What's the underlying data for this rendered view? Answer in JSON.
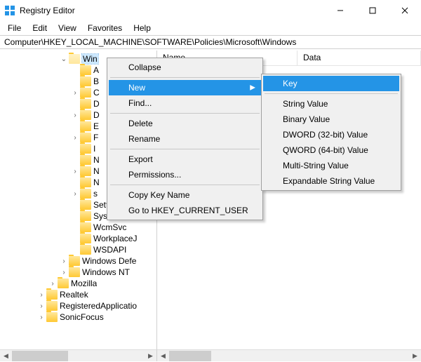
{
  "window": {
    "title": "Registry Editor"
  },
  "menubar": {
    "file": "File",
    "edit": "Edit",
    "view": "View",
    "favorites": "Favorites",
    "help": "Help"
  },
  "address": "Computer\\HKEY_LOCAL_MACHINE\\SOFTWARE\\Policies\\Microsoft\\Windows",
  "columns": {
    "name": "Name",
    "data": "Data"
  },
  "tree": [
    {
      "indent": 84,
      "chev": "down",
      "open": true,
      "label": "Win",
      "selected": true
    },
    {
      "indent": 100,
      "chev": "none",
      "label": "A"
    },
    {
      "indent": 100,
      "chev": "none",
      "label": "B"
    },
    {
      "indent": 100,
      "chev": "right",
      "label": "C"
    },
    {
      "indent": 100,
      "chev": "none",
      "label": "D"
    },
    {
      "indent": 100,
      "chev": "right",
      "label": "D"
    },
    {
      "indent": 100,
      "chev": "none",
      "label": "E"
    },
    {
      "indent": 100,
      "chev": "right",
      "label": "F"
    },
    {
      "indent": 100,
      "chev": "none",
      "label": "I"
    },
    {
      "indent": 100,
      "chev": "none",
      "label": "N"
    },
    {
      "indent": 100,
      "chev": "right",
      "label": "N"
    },
    {
      "indent": 100,
      "chev": "none",
      "label": "N"
    },
    {
      "indent": 100,
      "chev": "right",
      "label": "s"
    },
    {
      "indent": 100,
      "chev": "none",
      "label": "SettingSync"
    },
    {
      "indent": 100,
      "chev": "none",
      "label": "System"
    },
    {
      "indent": 100,
      "chev": "none",
      "label": "WcmSvc"
    },
    {
      "indent": 100,
      "chev": "none",
      "label": "WorkplaceJ"
    },
    {
      "indent": 100,
      "chev": "none",
      "label": "WSDAPI"
    },
    {
      "indent": 84,
      "chev": "right",
      "label": "Windows Defe"
    },
    {
      "indent": 84,
      "chev": "right",
      "label": "Windows NT"
    },
    {
      "indent": 68,
      "chev": "right",
      "label": "Mozilla"
    },
    {
      "indent": 52,
      "chev": "right",
      "label": "Realtek"
    },
    {
      "indent": 52,
      "chev": "right",
      "label": "RegisteredApplicatio"
    },
    {
      "indent": 52,
      "chev": "right",
      "label": "SonicFocus"
    }
  ],
  "context_menu": {
    "collapse": "Collapse",
    "new": "New",
    "find": "Find...",
    "delete": "Delete",
    "rename": "Rename",
    "export": "Export",
    "permissions": "Permissions...",
    "copy_key_name": "Copy Key Name",
    "goto_hkcu": "Go to HKEY_CURRENT_USER"
  },
  "submenu": {
    "key": "Key",
    "string": "String Value",
    "binary": "Binary Value",
    "dword": "DWORD (32-bit) Value",
    "qword": "QWORD (64-bit) Value",
    "multistring": "Multi-String Value",
    "expandable": "Expandable String Value"
  }
}
